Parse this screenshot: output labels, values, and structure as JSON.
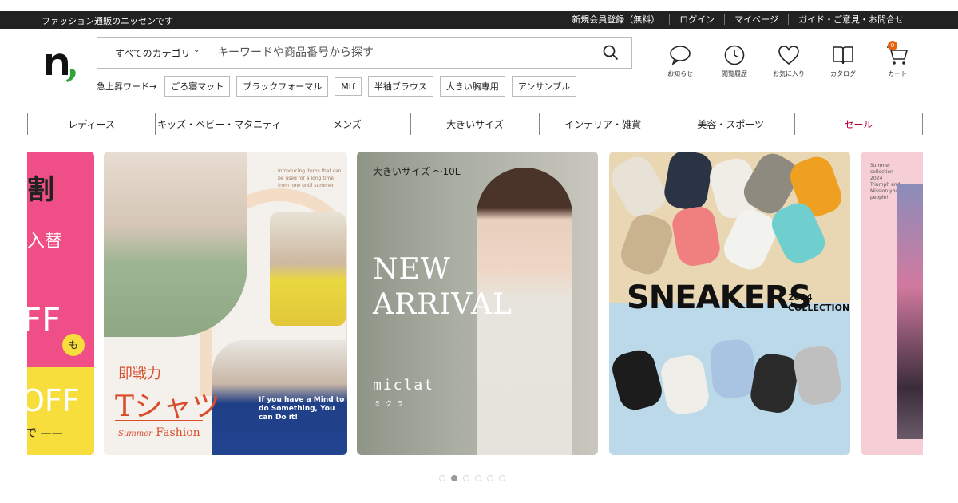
{
  "topbar": {
    "tagline": "ファッション通販のニッセンです",
    "links": [
      "新規会員登録（無料）",
      "ログイン",
      "マイページ",
      "ガイド・ご意見・お問合せ"
    ]
  },
  "search": {
    "category": "すべてのカテゴリ",
    "placeholder": "キーワードや商品番号から探す"
  },
  "trending": {
    "label": "急上昇ワード→",
    "chips": [
      "ごろ寝マット",
      "ブラックフォーマル",
      "Mtf",
      "半袖ブラウス",
      "大きい胸専用",
      "アンサンブル"
    ]
  },
  "header_icons": {
    "notice": "お知らせ",
    "history": "閲覧履歴",
    "favorites": "お気に入り",
    "catalog": "カタログ",
    "cart": "カート",
    "cart_count": "0"
  },
  "categories": [
    "レディース",
    "キッズ・ベビー・マタニティ",
    "メンズ",
    "大きいサイズ",
    "インテリア・雑貨",
    "美容・スポーツ",
    "セール"
  ],
  "banners": {
    "left": {
      "line1": "割",
      "line2": "入替",
      "line3": "FF",
      "badge": "も",
      "line4": "OFF",
      "line5": "で ——"
    },
    "tshirt": {
      "caption": "Introducing items that can be used for a long time from now until summer",
      "subtitle": "即戦力",
      "title": "Tシャツ",
      "footer_small": "Summer",
      "footer": "Fashion",
      "shirt_text": "If you have a Mind to do Something, You can Do it!"
    },
    "miclat": {
      "tag": "大きいサイズ ～10L",
      "headline1": "NEW",
      "headline2": "ARRIVAL",
      "brand": "miclat",
      "brand_kana": "ミクラ"
    },
    "sneakers": {
      "title": "SNEAKERS",
      "year": "2024",
      "collection": "COLLECTION"
    },
    "right": {
      "caption": "Summer collection 2024 Triumph and Mission your people!"
    }
  },
  "carousel": {
    "active_index": 1,
    "count": 6
  },
  "colors": {
    "accent_sale": "#b3002d",
    "cart_badge": "#e8640c",
    "topbar": "#222222"
  }
}
